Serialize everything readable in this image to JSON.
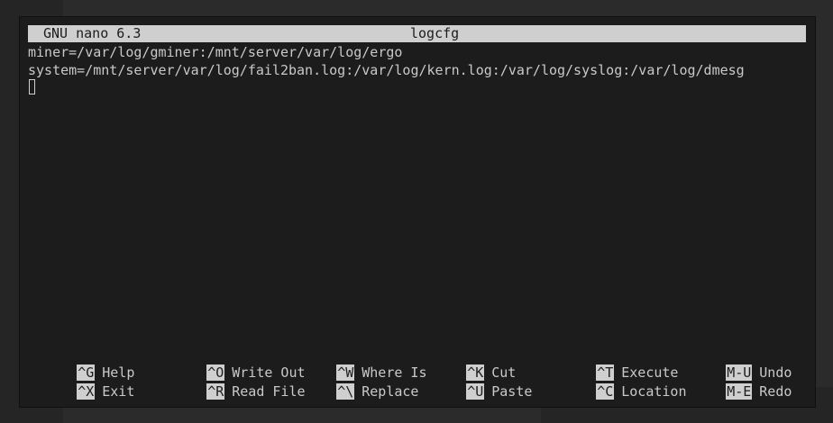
{
  "titlebar": {
    "app_version": "GNU nano 6.3",
    "file_name": "logcfg"
  },
  "editor": {
    "lines": [
      "miner=/var/log/gminer:/mnt/server/var/log/ergo",
      "system=/mnt/server/var/log/fail2ban.log:/var/log/kern.log:/var/log/syslog:/var/log/dmesg"
    ]
  },
  "shortcuts": [
    {
      "key": "^G",
      "label": "Help"
    },
    {
      "key": "^O",
      "label": "Write Out"
    },
    {
      "key": "^W",
      "label": "Where Is"
    },
    {
      "key": "^K",
      "label": "Cut"
    },
    {
      "key": "^T",
      "label": "Execute"
    },
    {
      "key": "M-U",
      "label": "Undo"
    },
    {
      "key": "^X",
      "label": "Exit"
    },
    {
      "key": "^R",
      "label": "Read File"
    },
    {
      "key": "^\\",
      "label": "Replace"
    },
    {
      "key": "^U",
      "label": "Paste"
    },
    {
      "key": "^C",
      "label": "Location"
    },
    {
      "key": "M-E",
      "label": "Redo"
    }
  ],
  "colors": {
    "terminal_bg": "#1c1c1c",
    "text": "#c9c9c9",
    "inverse_bg": "#cfcfcf"
  }
}
